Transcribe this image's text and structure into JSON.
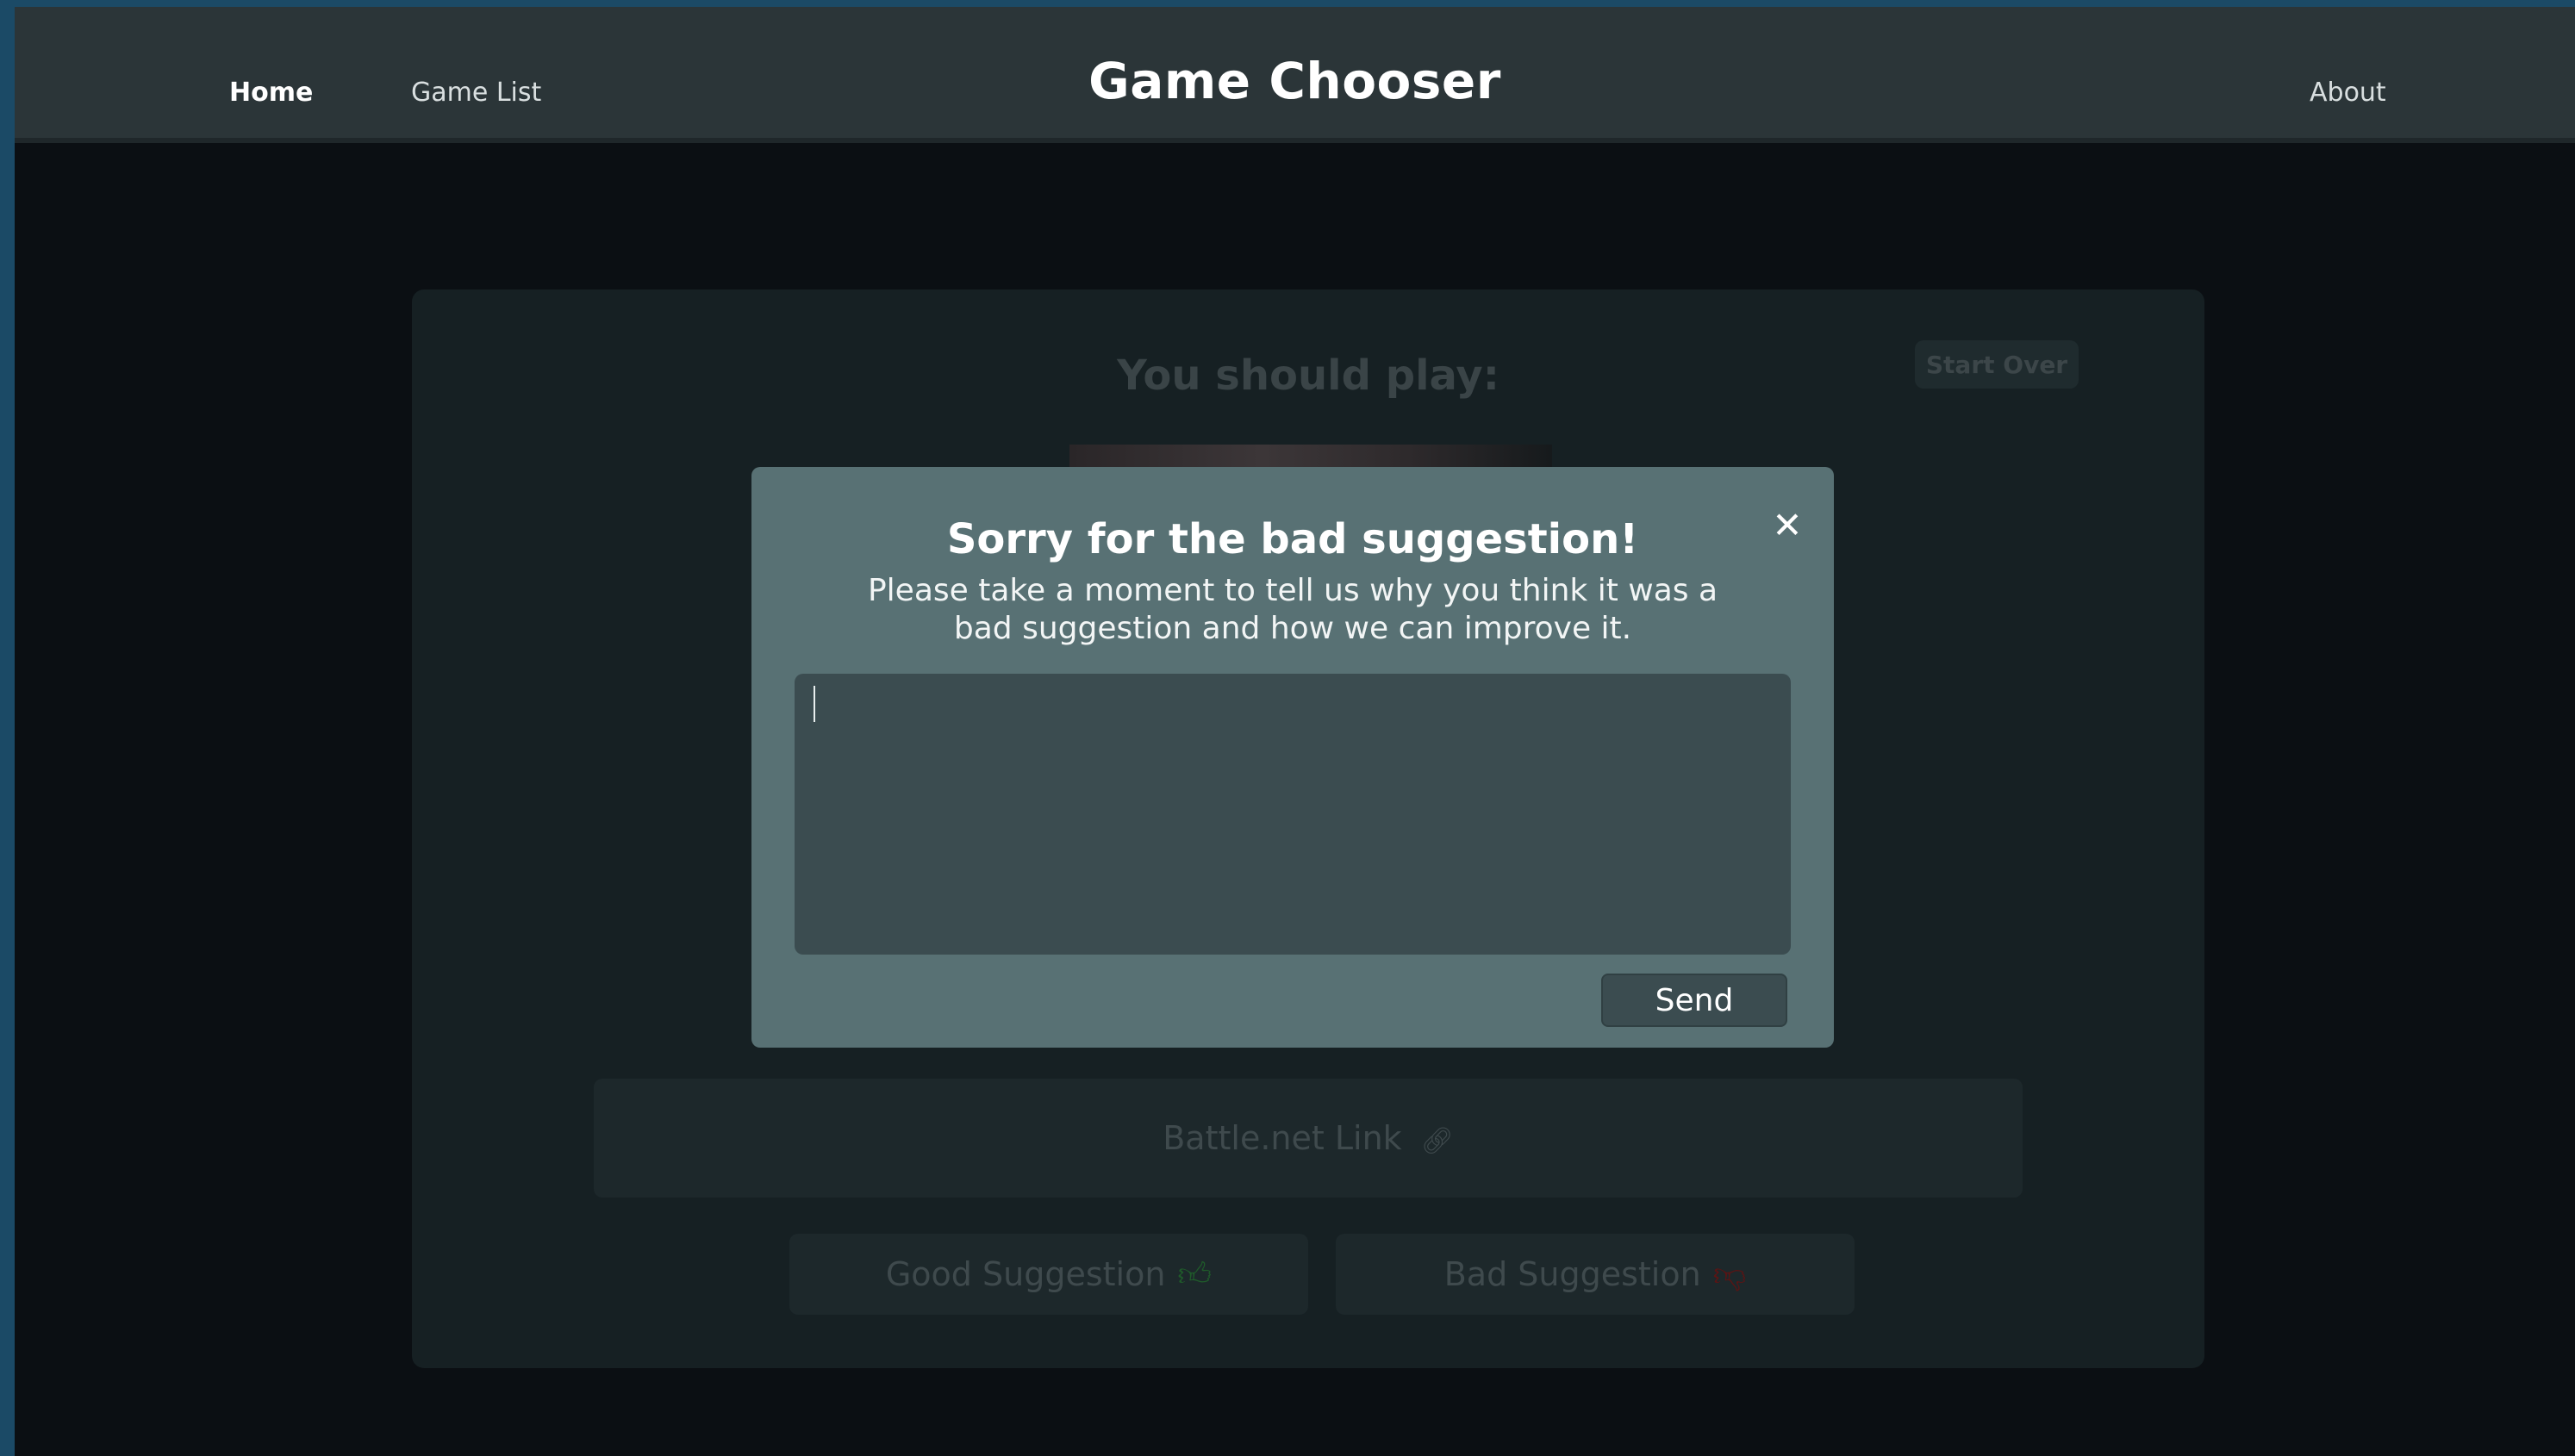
{
  "nav": {
    "home": "Home",
    "game_list": "Game List",
    "brand": "Game Chooser",
    "about": "About"
  },
  "card": {
    "title": "You should play:",
    "start_over": "Start Over",
    "store_link": "Battle.net Link",
    "good_suggestion": "Good Suggestion",
    "bad_suggestion": "Bad Suggestion"
  },
  "modal": {
    "title": "Sorry for the bad suggestion!",
    "description": "Please take a moment to tell us why you think it was a bad suggestion and how we can improve it.",
    "input_value": "",
    "send": "Send"
  },
  "icons": {
    "link": "link-icon",
    "thumbs_up": "thumbs-up-icon",
    "thumbs_down": "thumbs-down-icon",
    "close": "close-icon"
  },
  "colors": {
    "navbar": "#2b3538",
    "modal": "#587174",
    "thumbs_up": "#1f5a2a",
    "thumbs_down": "#5a1414"
  }
}
